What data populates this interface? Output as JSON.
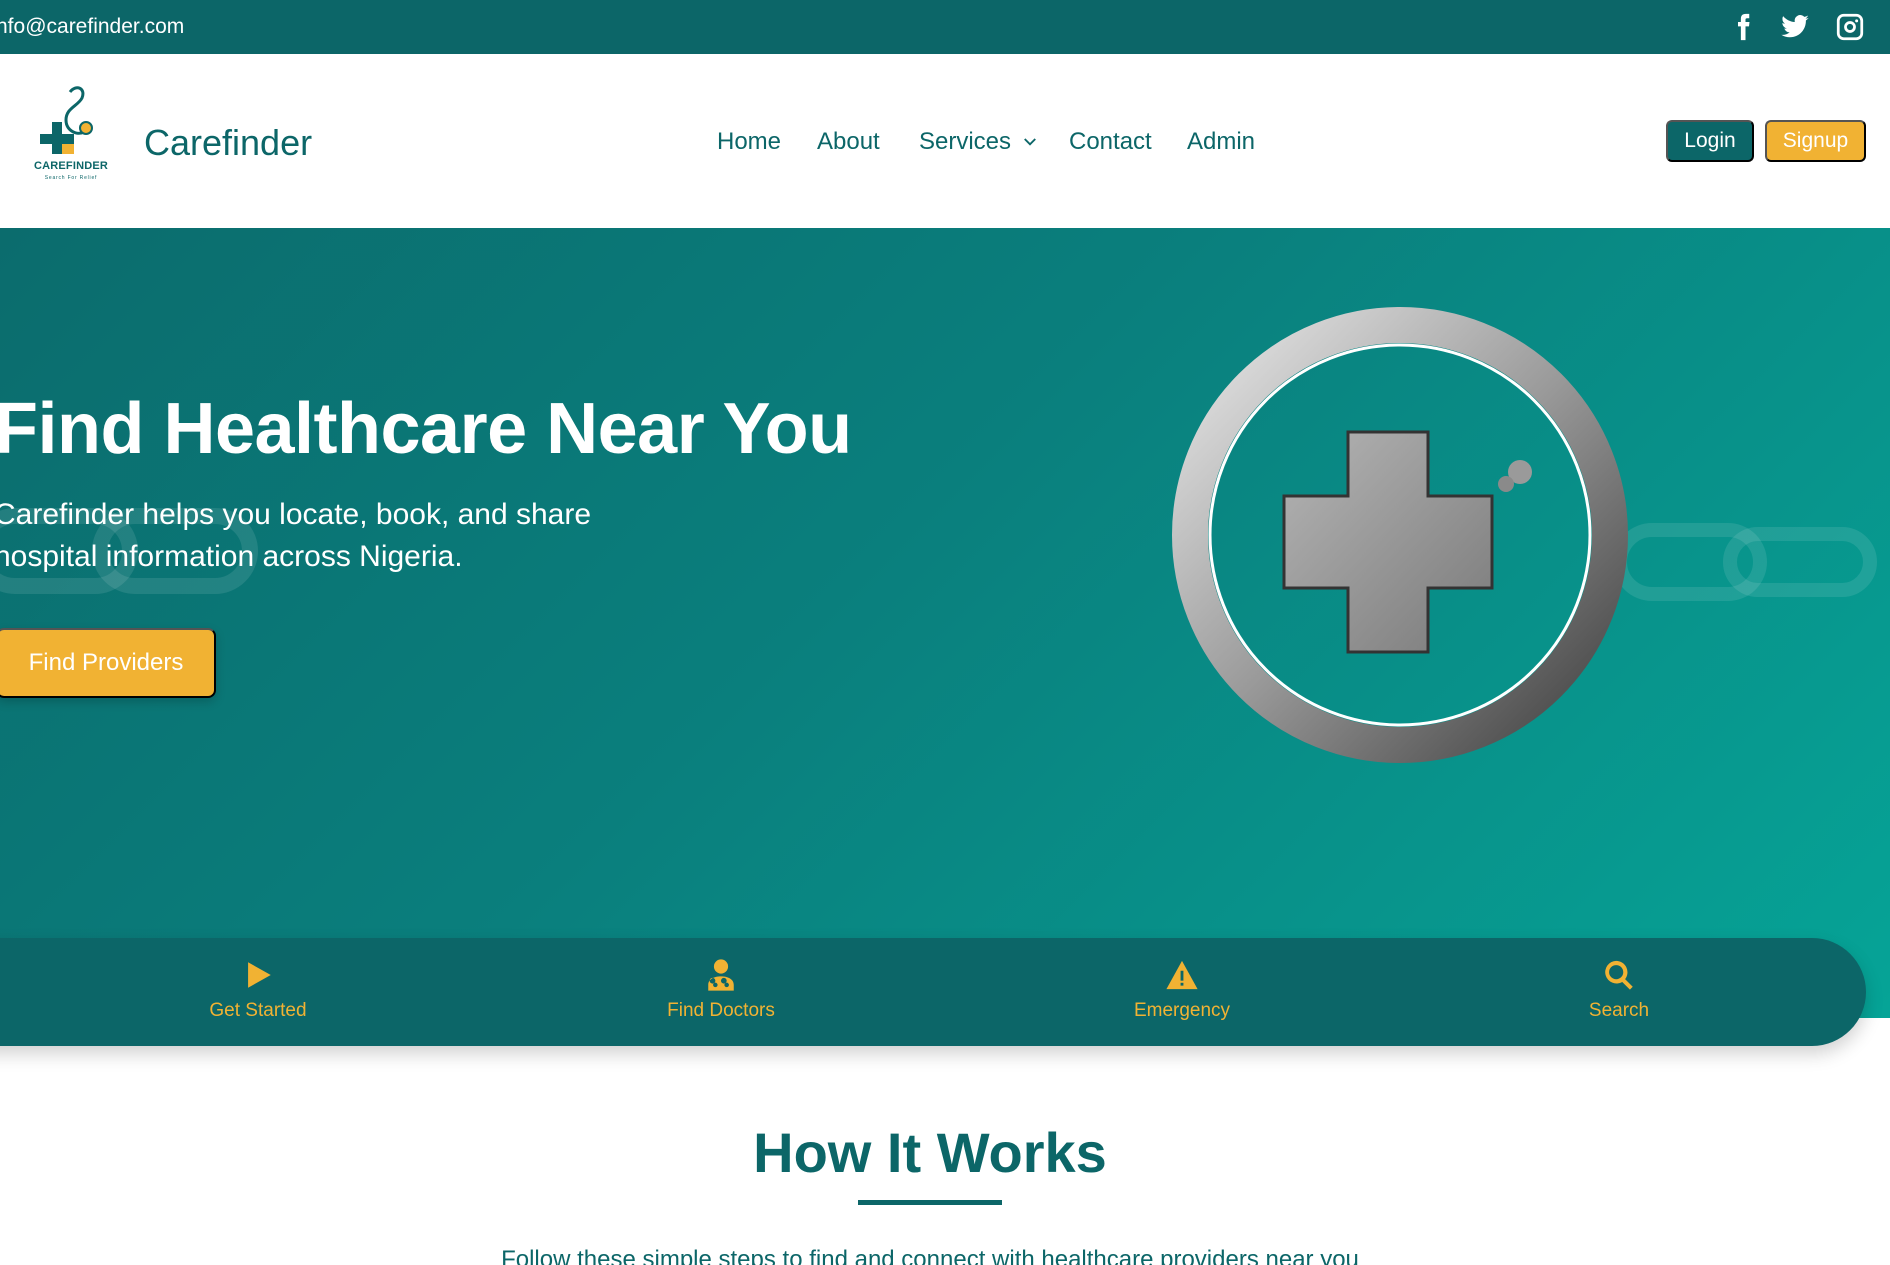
{
  "topbar": {
    "email": "nfo@carefinder.com",
    "social": [
      {
        "icon": "facebook-icon"
      },
      {
        "icon": "twitter-icon"
      },
      {
        "icon": "instagram-icon"
      }
    ]
  },
  "header": {
    "logo_text": "CAREFINDER",
    "logo_tagline": "Search For Relief",
    "brand": "Carefinder",
    "nav": {
      "home": "Home",
      "about": "About",
      "services": "Services",
      "contact": "Contact",
      "admin": "Admin"
    },
    "login": "Login",
    "signup": "Signup"
  },
  "hero": {
    "title": "Find Healthcare Near You",
    "subtitle_line1": "Carefinder helps you locate, book, and share",
    "subtitle_line2": "hospital information across Nigeria.",
    "cta": "Find Providers"
  },
  "quickbar": {
    "items": [
      {
        "label": "Get Started",
        "icon": "play-icon"
      },
      {
        "label": "Find Doctors",
        "icon": "doctor-icon"
      },
      {
        "label": "Emergency",
        "icon": "warning-icon"
      },
      {
        "label": "Search",
        "icon": "search-icon"
      }
    ]
  },
  "how": {
    "title": "How It Works",
    "subtitle": "Follow these simple steps to find and connect with healthcare providers near you"
  },
  "colors": {
    "primary": "#0c6668",
    "accent": "#f1b233",
    "hero_end": "#06a497"
  }
}
